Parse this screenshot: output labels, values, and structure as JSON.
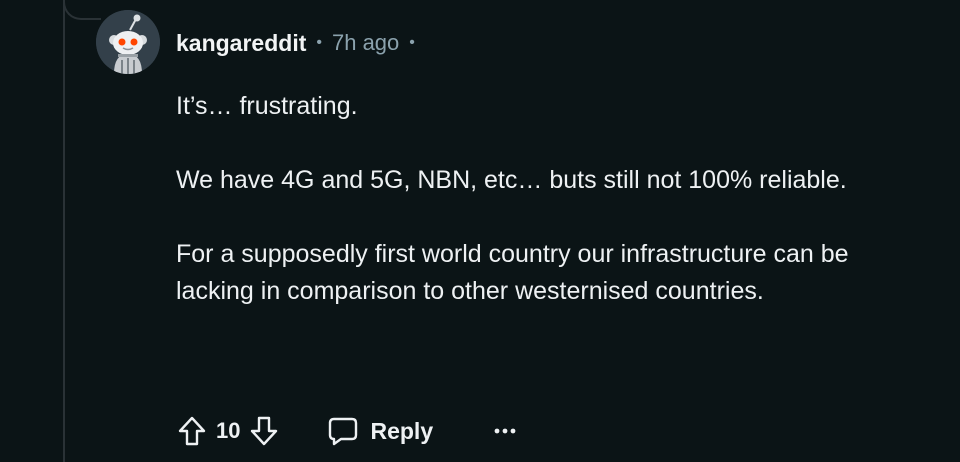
{
  "comment": {
    "author": "kangareddit",
    "separator": "•",
    "timestamp": "7h ago",
    "paragraphs": [
      "It’s… frustrating.",
      "We have 4G and 5G, NBN, etc… buts still not 100% reliable.",
      "For a supposedly first world country our infrastructure can be lacking in comparison to other westernised countries."
    ],
    "avatar_icon": "snoo-avatar",
    "colors": {
      "background": "#0b1416",
      "text": "#eef1f3",
      "meta": "#8ba2ad",
      "thread_line": "#2a3236"
    }
  },
  "actions": {
    "upvote_icon": "arrow-up-icon",
    "score": "10",
    "downvote_icon": "arrow-down-icon",
    "reply_icon": "speech-bubble-icon",
    "reply_label": "Reply",
    "more_icon": "ellipsis-icon"
  }
}
